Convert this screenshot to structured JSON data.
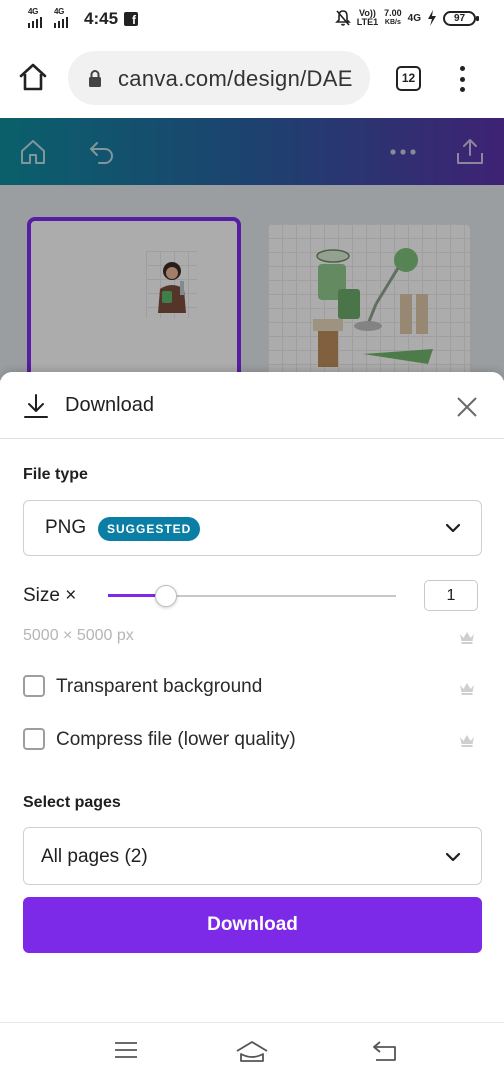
{
  "status_bar": {
    "network_1": "4G",
    "network_2": "4G",
    "time": "4:45",
    "volte_top": "Vo))",
    "volte_bottom": "LTE1",
    "speed_value": "7.00",
    "speed_unit": "KB/s",
    "network_3": "4G",
    "battery": "97",
    "icons": [
      "signal-icon",
      "facebook-icon",
      "mute-icon",
      "charging-icon",
      "battery-icon"
    ]
  },
  "browser": {
    "url": "canva.com/design/DAE",
    "tab_count": "12",
    "icons": [
      "home-icon",
      "lock-icon",
      "more-vertical-icon"
    ]
  },
  "canva_header": {
    "icons": [
      "home-icon",
      "undo-icon",
      "more-horizontal-icon",
      "share-icon"
    ],
    "gradient": [
      "#0e8a9a",
      "#2a5fa0",
      "#5a31a6"
    ]
  },
  "download_panel": {
    "title": "Download",
    "file_type_label": "File type",
    "file_type_value": "PNG",
    "suggested_badge": "SUGGESTED",
    "size_label": "Size ×",
    "size_value": "1",
    "size_slider_fraction": 0.2,
    "dimensions": "5000 × 5000 px",
    "transparent_background_label": "Transparent background",
    "transparent_background_checked": false,
    "compress_file_label": "Compress file (lower quality)",
    "compress_file_checked": false,
    "select_pages_label": "Select pages",
    "select_pages_value": "All pages (2)",
    "download_button_label": "Download"
  },
  "nav_bar": {
    "icons": [
      "menu-icon",
      "home-icon",
      "back-icon"
    ]
  },
  "colors": {
    "accent": "#7d2ae8",
    "badge": "#0a7ea4",
    "muted_text": "#b5b5b5"
  }
}
